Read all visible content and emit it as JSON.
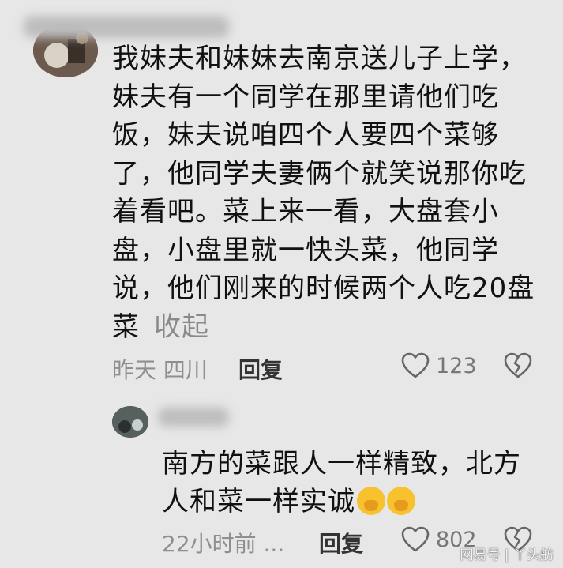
{
  "comment": {
    "text": "我妹夫和妹妹去南京送儿子上学，妹夫有一个同学在那里请他们吃饭，妹夫说咱四个人要四个菜够了，他同学夫妻俩个就笑说那你吃着看吧。菜上来一看，大盘套小盘，小盘里就一快头菜，他同学说，他们刚来的时候两个人吃20盘菜",
    "collapse_label": "收起",
    "time_location": "昨天 四川",
    "reply_label": "回复",
    "like_count": "123"
  },
  "reply": {
    "text": "南方的菜跟人一样精致，北方人和菜一样实诚",
    "emoji": "smirk-emoji",
    "time": "22小时前 ...",
    "reply_label": "回复",
    "like_count": "802"
  },
  "watermark": "网易号 | 丫头舫",
  "icons": {
    "like": "heart-outline-icon",
    "dislike": "broken-heart-icon"
  }
}
